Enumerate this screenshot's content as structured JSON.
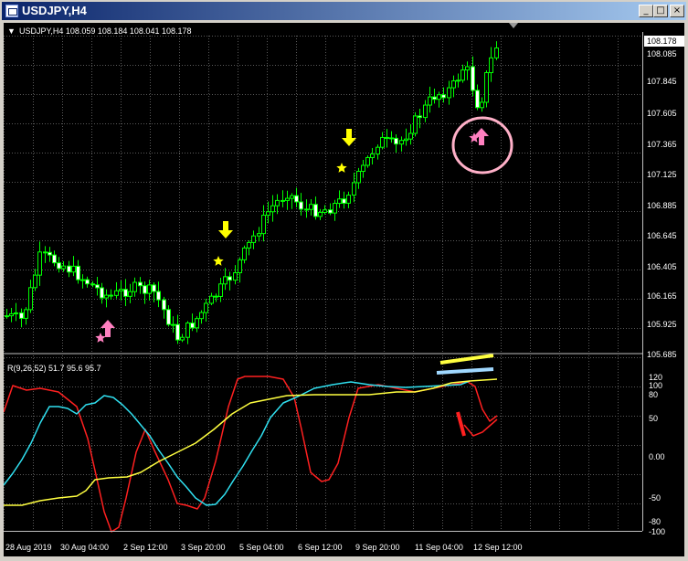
{
  "window": {
    "title": "USDJPY,H4",
    "buttons": {
      "minimize": "_",
      "maximize": "□",
      "close": "×"
    }
  },
  "chart": {
    "header_prefix": "▼",
    "header": "USDJPY,H4  108.059 108.184 108.041 108.178",
    "current_price": "108.178",
    "price_axis": [
      "108.085",
      "107.845",
      "107.605",
      "107.365",
      "107.125",
      "106.885",
      "106.645",
      "106.405",
      "106.165",
      "105.925",
      "105.685"
    ],
    "indicator_header": "R(9,26,52) 51.7 95.6 95.7",
    "indicator_axis": [
      "120",
      "100",
      "80",
      "50",
      "0.00",
      "-50",
      "-80",
      "-100"
    ],
    "time_axis": [
      "28 Aug 2019",
      "30 Aug 04:00",
      "2 Sep 12:00",
      "3 Sep 20:00",
      "5 Sep 04:00",
      "6 Sep 12:00",
      "9 Sep 20:00",
      "11 Sep 04:00",
      "12 Sep 12:00"
    ],
    "colors": {
      "background": "#000000",
      "grid": "#5a5a5a",
      "candles": "#00ff00",
      "line_red": "#ff2020",
      "line_cyan": "#30e0f0",
      "line_yellow": "#ffff40",
      "arrow_down": "#ffff00",
      "arrow_up": "#ff80c0",
      "circle": "#ffb0c8"
    },
    "markers": [
      {
        "type": "star",
        "color": "#ff80c0",
        "icon": "star-icon"
      },
      {
        "type": "arrow-up",
        "color": "#ff80c0",
        "icon": "arrow-up-icon"
      },
      {
        "type": "star",
        "color": "#ffff00",
        "icon": "star-icon"
      },
      {
        "type": "arrow-down",
        "color": "#ffff00",
        "icon": "arrow-down-icon"
      },
      {
        "type": "star",
        "color": "#ffff00",
        "icon": "star-icon"
      },
      {
        "type": "arrow-down",
        "color": "#ffff00",
        "icon": "arrow-down-icon"
      },
      {
        "type": "star",
        "color": "#ff80c0",
        "icon": "star-icon"
      },
      {
        "type": "arrow-up",
        "color": "#ff80c0",
        "icon": "arrow-up-icon"
      }
    ]
  }
}
